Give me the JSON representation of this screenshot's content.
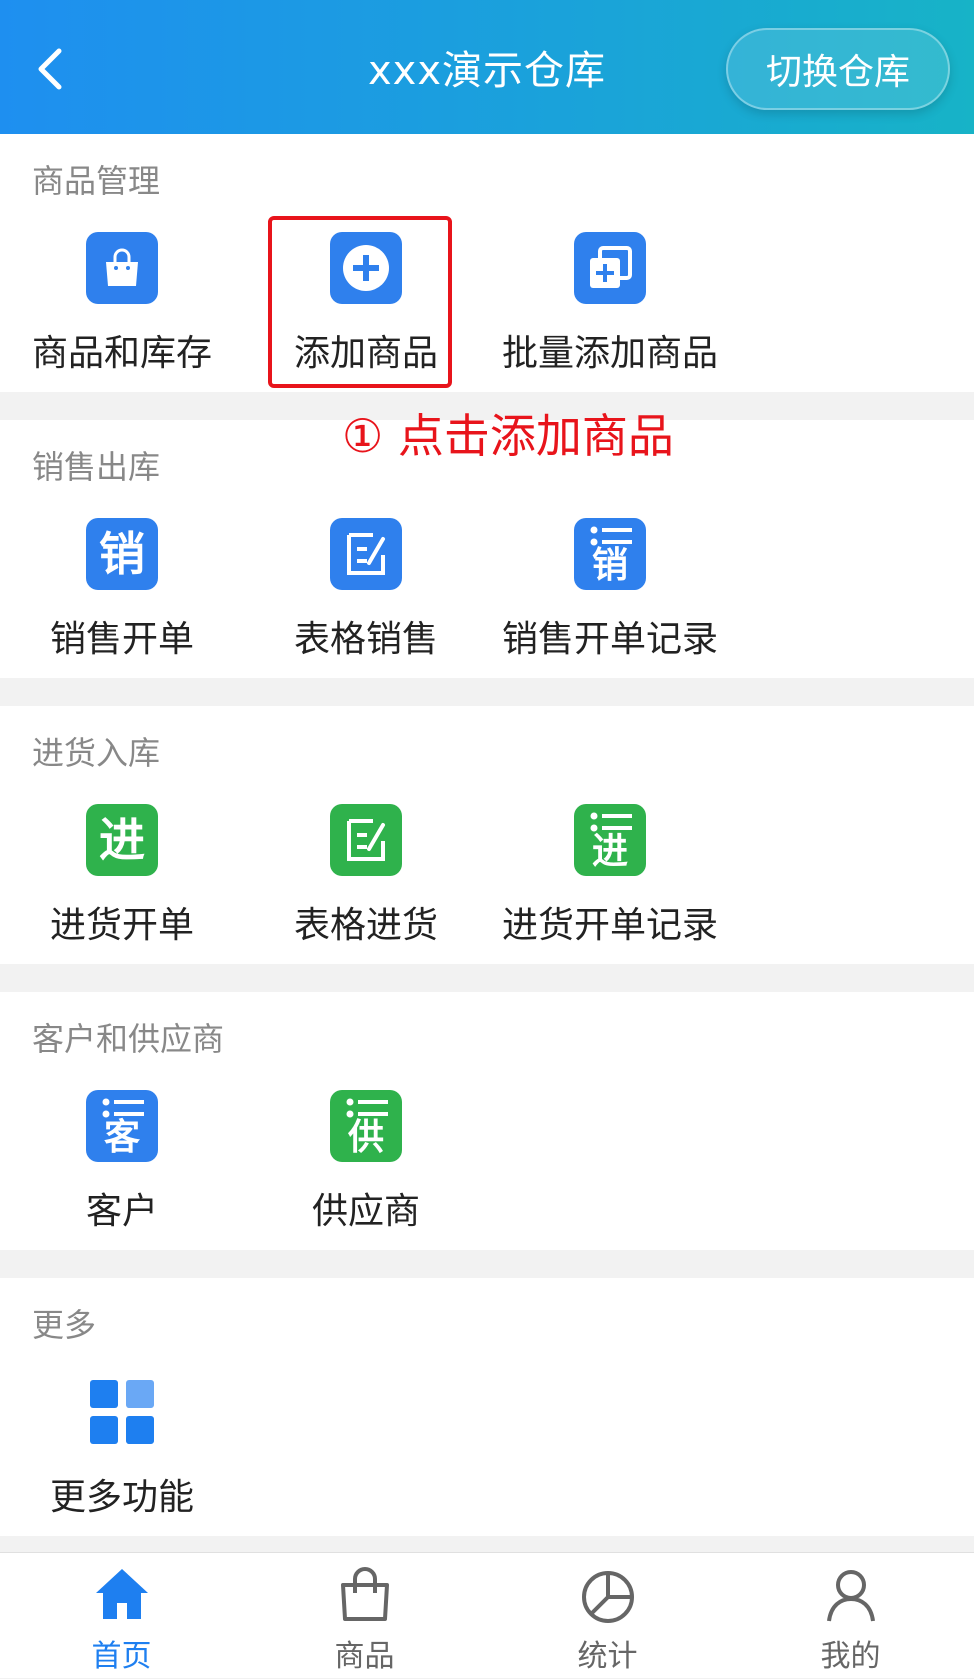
{
  "header": {
    "title": "xxx演示仓库",
    "switch_label": "切换仓库"
  },
  "sections": {
    "goods": {
      "title": "商品管理",
      "items": [
        "商品和库存",
        "添加商品",
        "批量添加商品"
      ]
    },
    "sales": {
      "title": "销售出库",
      "items": [
        "销售开单",
        "表格销售",
        "销售开单记录"
      ],
      "icon_chars": [
        "销",
        "销"
      ]
    },
    "purchase": {
      "title": "进货入库",
      "items": [
        "进货开单",
        "表格进货",
        "进货开单记录"
      ],
      "icon_chars": [
        "进",
        "进"
      ]
    },
    "partners": {
      "title": "客户和供应商",
      "items": [
        "客户",
        "供应商"
      ],
      "icon_chars": [
        "客",
        "供"
      ]
    },
    "more": {
      "title": "更多",
      "items": [
        "更多功能"
      ]
    }
  },
  "annotation": {
    "text": "① 点击添加商品",
    "color": "#e8141b"
  },
  "tabbar": {
    "items": [
      "首页",
      "商品",
      "统计",
      "我的"
    ],
    "active_index": 0
  },
  "colors": {
    "accent_blue": "#2f80ed",
    "accent_green": "#2fb24c",
    "header_gradient_start": "#1e8ff0",
    "header_gradient_end": "#17b3c7",
    "tab_active": "#1e7ff0"
  }
}
